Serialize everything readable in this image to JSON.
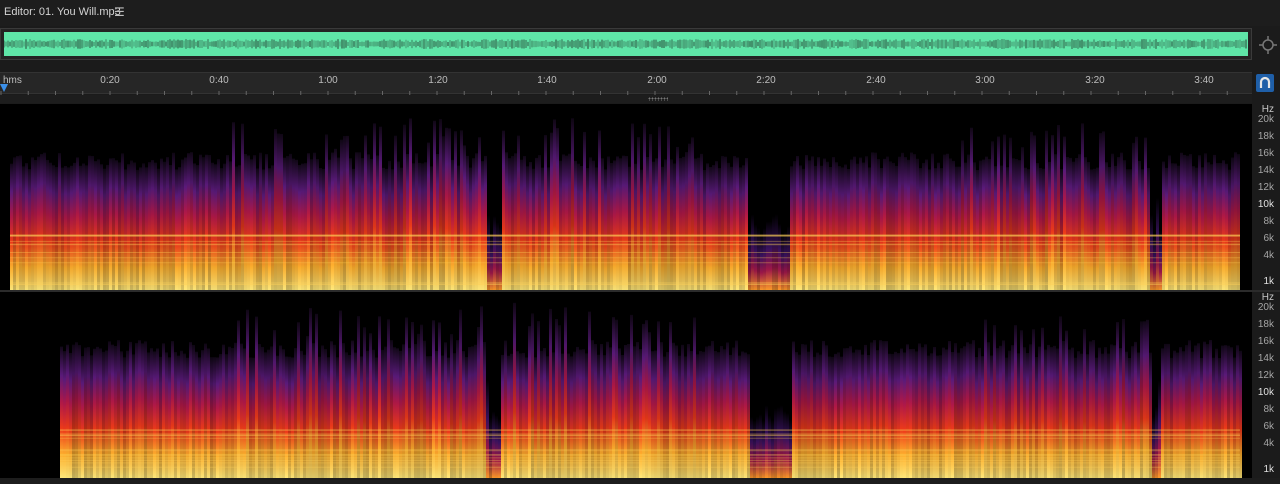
{
  "editor": {
    "title": "Editor: 01. You Will.mp3",
    "menu_icon": "hamburger-menu-icon"
  },
  "overview": {
    "wave_color": "#5fe6a8"
  },
  "ruler": {
    "unit": "hms",
    "labels": [
      "0:20",
      "0:40",
      "1:00",
      "1:20",
      "1:40",
      "2:00",
      "2:20",
      "2:40",
      "3:00",
      "3:20",
      "3:40"
    ]
  },
  "channels": [
    {
      "name": "channel-left",
      "scale_unit": "Hz",
      "scale_labels": [
        "20k",
        "18k",
        "16k",
        "14k",
        "12k",
        "10k",
        "8k",
        "6k",
        "4k",
        "1k"
      ]
    },
    {
      "name": "channel-right",
      "scale_unit": "Hz",
      "scale_labels": [
        "20k",
        "18k",
        "16k",
        "14k",
        "12k",
        "10k",
        "8k",
        "6k",
        "4k",
        "1k"
      ]
    }
  ],
  "colors": {
    "accent": "#1f5fa8",
    "spectrum_hot": "#ffe066",
    "spectrum_mid": "#e8281e",
    "spectrum_cool": "#6a1f8a"
  }
}
